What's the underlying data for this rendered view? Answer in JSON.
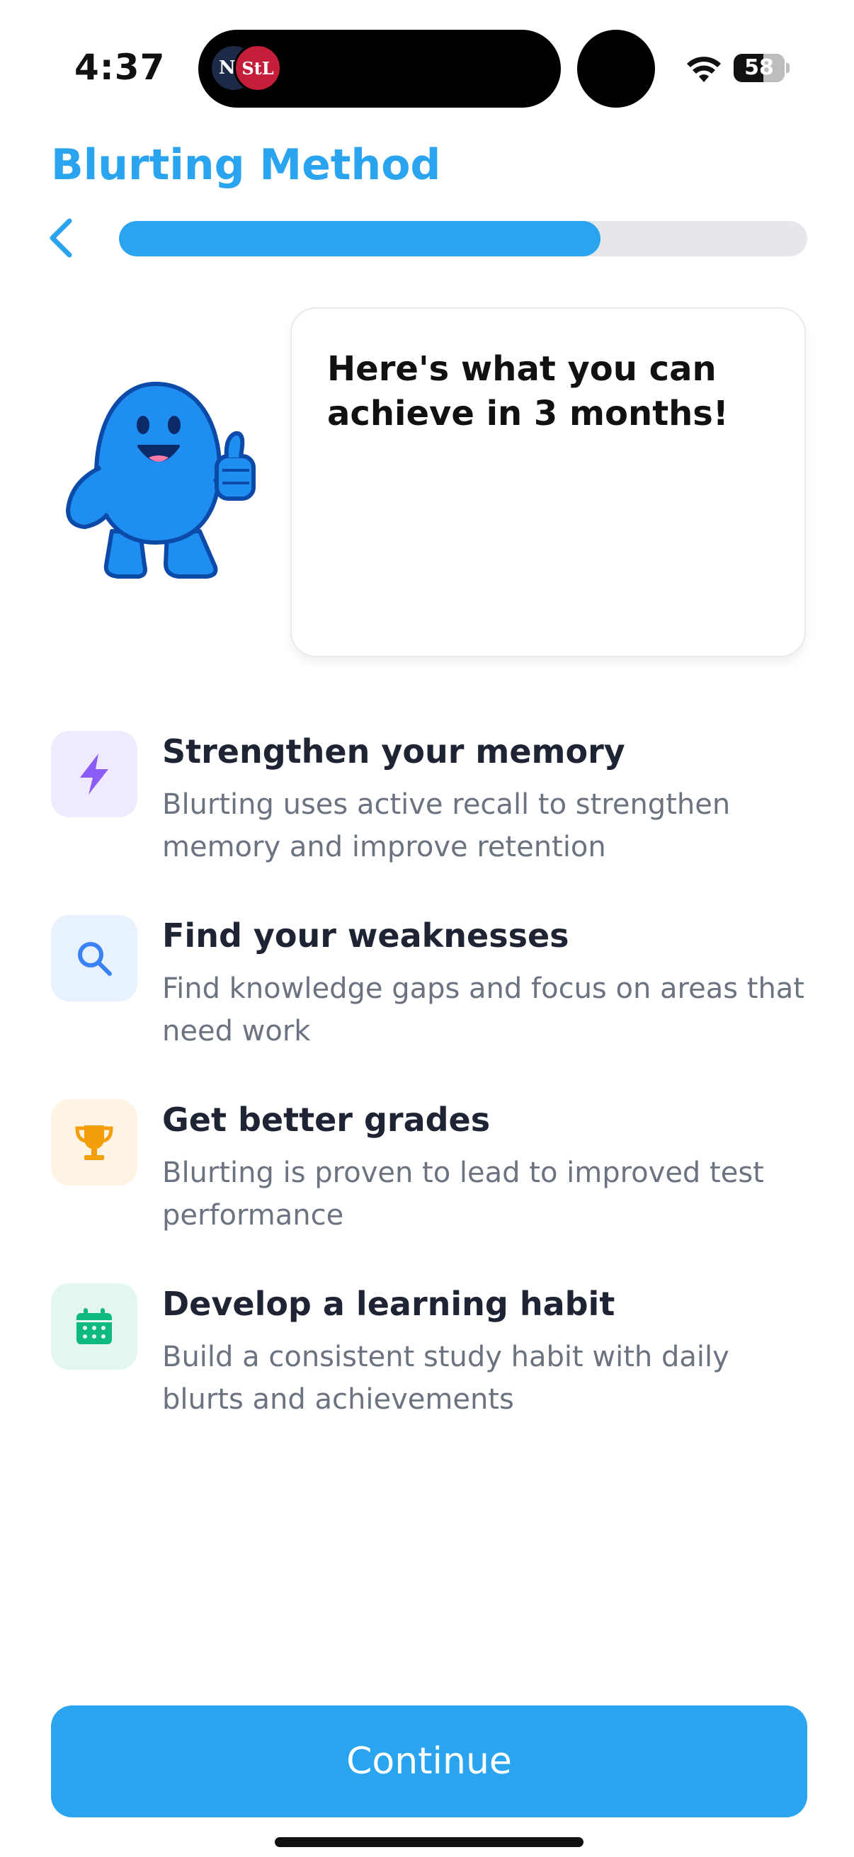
{
  "status_bar": {
    "time": "4:37",
    "battery": "58",
    "logos": [
      "NY",
      "StL"
    ]
  },
  "header": {
    "title": "Blurting Method",
    "progress_fraction": 0.7
  },
  "speech": {
    "text": "Here's what you can achieve in 3 months!"
  },
  "features": [
    {
      "icon": "lightning-icon",
      "title": "Strengthen your memory",
      "description": "Blurting uses active recall to strengthen memory and improve retention",
      "icon_bg": "#efeafe",
      "icon_color": "#8b5cf6"
    },
    {
      "icon": "search-icon",
      "title": "Find your weaknesses",
      "description": "Find knowledge gaps and focus on areas that need work",
      "icon_bg": "#e8f1fe",
      "icon_color": "#3b82f6"
    },
    {
      "icon": "trophy-icon",
      "title": "Get better grades",
      "description": "Blurting is proven to lead to improved test performance",
      "icon_bg": "#fff4e3",
      "icon_color": "#f59e0b"
    },
    {
      "icon": "calendar-icon",
      "title": "Develop a learning habit",
      "description": "Build a consistent study habit with daily blurts and achievements",
      "icon_bg": "#e3f7ee",
      "icon_color": "#10b981"
    }
  ],
  "continue_label": "Continue",
  "colors": {
    "accent": "#2aa4ee",
    "track": "#e6e7ea"
  }
}
